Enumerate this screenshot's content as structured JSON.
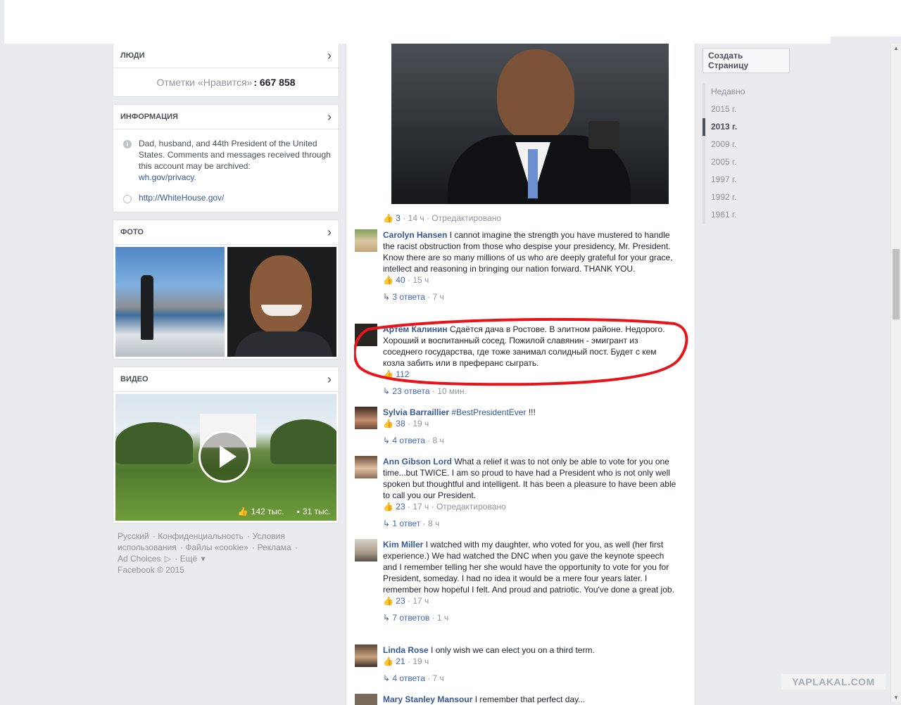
{
  "left": {
    "people": {
      "title": "ЛЮДИ",
      "likes_label": "Отметки «Нравится»",
      "likes_value": ": 667 858"
    },
    "info": {
      "title": "ИНФОРМАЦИЯ",
      "about": "Dad, husband, and 44th President of the United States. Comments and messages received through this account may be archived:",
      "about_link": "wh.gov/privacy",
      "website": "http://WhiteHouse.gov/"
    },
    "photos": {
      "title": "ФОТО"
    },
    "videos": {
      "title": "ВИДЕО",
      "likes": "142 тыс.",
      "comments": "31 тыс."
    },
    "footer": {
      "lang": "Русский",
      "items": [
        "Конфиденциальность",
        "Условия использования",
        "Файлы «cookie»",
        "Реклама",
        "Ad Choices",
        "Ещё"
      ],
      "copyright": "Facebook © 2015"
    }
  },
  "post": {
    "likes": "3",
    "time": "14 ч",
    "edited": "Отредактировано"
  },
  "comments": [
    {
      "name": "Carolyn Hansen",
      "text": "I cannot imagine the strength you have mustered to handle the racist obstruction from those who despise your presidency, Mr. President. Know there are so many millions of us who are deeply grateful for your grace, intellect and reasoning in bringing our nation forward. THANK YOU.",
      "likes": "40",
      "time": "15 ч",
      "replies": "3 ответа",
      "replies_time": "7 ч"
    },
    {
      "name": "Артём Калинин",
      "text": "Сдаётся дача в Ростове. В элитном районе. Недорого. Хороший и воспитанный сосед. Пожилой славянин - эмигрант из соседнего государства, где тоже занимал солидный пост. Будет с кем козла забить или в преферанс сыграть.",
      "likes": "112",
      "replies": "23 ответа",
      "replies_time": "10 мин."
    },
    {
      "name": "Sylvia Barraillier",
      "hashtag": "#BestPresidentEver",
      "text": "!!!",
      "likes": "38",
      "time": "19 ч",
      "replies": "4 ответа",
      "replies_time": "8 ч"
    },
    {
      "name": "Ann Gibson Lord",
      "text": "What a relief it was to not only be able to vote for you one time...but TWICE. I am so proud to have had a President who is not only well spoken but thoughtful and intelligent. It has been a pleasure to have been able to call you our President.",
      "likes": "23",
      "time": "17 ч",
      "edited": "Отредактировано",
      "replies": "1 ответ",
      "replies_time": "8 ч"
    },
    {
      "name": "Kim Miller",
      "text": "I watched with my daughter, who voted for you, as well (her first experience.) We had watched the DNC when you gave the keynote speech and I remember telling her she would have the opportunity to vote for you for President, someday. I had no idea it would be a mere four years later. I remember how hopeful I felt. And proud and patriotic. You've done a great job.",
      "likes": "23",
      "time": "17 ч",
      "replies": "7 ответов",
      "replies_time": "1 ч"
    },
    {
      "name": "Linda Rose",
      "text": "I only wish we can elect you on a third term.",
      "likes": "21",
      "time": "19 ч",
      "replies": "4 ответа",
      "replies_time": "7 ч"
    },
    {
      "name": "Mary Stanley Mansour",
      "text": "I remember that perfect day..."
    }
  ],
  "right": {
    "create_page": "Создать Страницу",
    "timeline": [
      "Недавно",
      "2015 г.",
      "2013 г.",
      "2009 г.",
      "2005 г.",
      "1997 г.",
      "1992 г.",
      "1961 г."
    ],
    "active": "2013 г."
  },
  "watermark": "YAPLAKAL.COM",
  "colors": {
    "link": "#365899",
    "annotation": "#e8141b",
    "bg": "#e9ebee"
  }
}
